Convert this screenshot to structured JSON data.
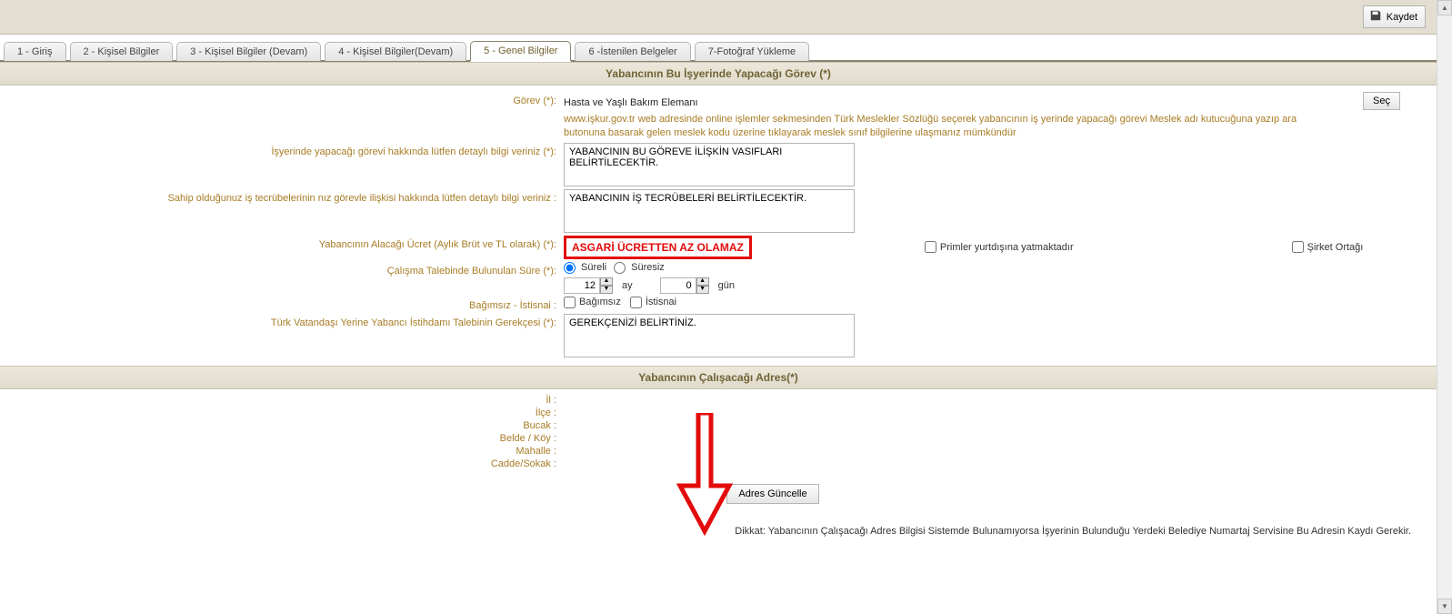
{
  "toolbar": {
    "save_label": "Kaydet"
  },
  "tabs": [
    "1 - Giriş",
    "2 - Kişisel Bilgiler",
    "3 - Kişisel Bilgiler (Devam)",
    "4 - Kişisel Bilgiler(Devam)",
    "5 - Genel Bilgiler",
    "6 -İstenilen Belgeler",
    "7-Fotoğraf Yükleme"
  ],
  "active_tab_index": 4,
  "section1": {
    "title": "Yabancının Bu İşyerinde Yapacağı Görev (*)",
    "gorev_label": "Görev (*):",
    "gorev_value": "Hasta ve Yaşlı Bakım Elemanı",
    "sec_btn": "Seç",
    "hint": "www.işkur.gov.tr web adresinde online işlemler sekmesinden Türk Meslekler Sözlüğü seçerek yabancının iş yerinde yapacağı görevi Meslek adı kutucuğuna yazıp ara butonuna basarak gelen meslek kodu üzerine tıklayarak meslek sınıf bilgilerine ulaşmanız mümkündür",
    "detay_label": "İşyerinde yapacağı görevi hakkında lütfen detaylı bilgi veriniz (*):",
    "detay_value": "YABANCININ BU GÖREVE İLİŞKİN VASIFLARI BELİRTİLECEKTİR.",
    "tecrube_label": "Sahip olduğunuz iş tecrübelerinin nız görevle ilişkisi hakkında lütfen detaylı bilgi veriniz :",
    "tecrube_value": "YABANCININ İŞ TECRÜBELERİ BELİRTİLECEKTİR.",
    "ucret_label": "Yabancının Alacağı Ücret (Aylık Brüt ve TL olarak) (*):",
    "ucret_box": "ASGARİ ÜCRETTEN AZ OLAMAZ",
    "primler_label": "Primler yurtdışına yatmaktadır",
    "sirket_label": "Şirket Ortağı",
    "sure_label": "Çalışma Talebinde Bulunulan Süre (*):",
    "sureli": "Süreli",
    "suresiz": "Süresiz",
    "ay_value": "12",
    "ay_label": "ay",
    "gun_value": "0",
    "gun_label": "gün",
    "bagimsiz_label_row": "Bağımsız - İstisnai :",
    "bagimsiz": "Bağımsız",
    "istisnai": "İstisnai",
    "gerekce_label": "Türk Vatandaşı Yerine Yabancı İstihdamı Talebinin Gerekçesi (*):",
    "gerekce_value": "GEREKÇENİZİ BELİRTİNİZ."
  },
  "section2": {
    "title": "Yabancının Çalışacağı Adres(*)",
    "il": "İl :",
    "ilce": "İlçe :",
    "bucak": "Bucak :",
    "belde": "Belde / Köy :",
    "mahalle": "Mahalle :",
    "cadde": "Cadde/Sokak :",
    "button": "Adres Güncelle",
    "warning": "Dikkat: Yabancının Çalışacağı Adres Bilgisi Sistemde Bulunamıyorsa İşyerinin Bulunduğu Yerdeki Belediye Numartaj Servisine Bu Adresin Kaydı Gerekir."
  }
}
